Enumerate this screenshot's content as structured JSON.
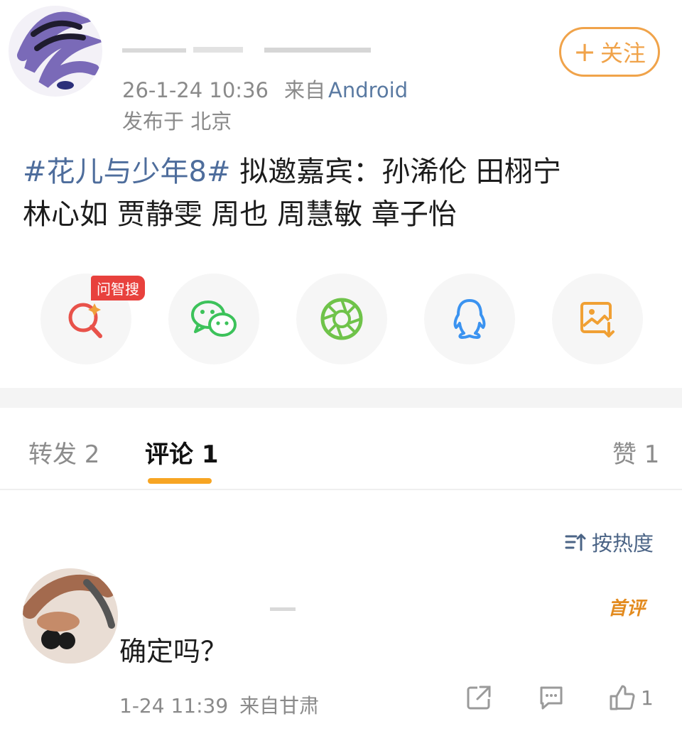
{
  "post": {
    "author_name": "",
    "timestamp": "26-1-24 10:36",
    "source_prefix": "来自",
    "source": "Android",
    "location": "发布于 北京",
    "follow_label": "关注",
    "hashtag": "#花儿与少年8#",
    "text_line1_rest": "拟邀嘉宾：孙浠伦 田栩宁",
    "text_line2": "林心如 贾静雯 周也 周慧敏 章子怡"
  },
  "share": {
    "ai_badge": "问智搜",
    "items": [
      "ai-search",
      "wechat",
      "moments",
      "qq",
      "save-image"
    ],
    "colors": {
      "ai_search": "#e8524a",
      "wechat": "#3cc25a",
      "moments": "#6fc34a",
      "qq": "#3b93f0",
      "save": "#f0a034"
    }
  },
  "tabs": {
    "repost": "转发 2",
    "comments": "评论 1",
    "likes": "赞 1"
  },
  "sort_label": "按热度",
  "comment": {
    "user_name": "",
    "first_badge": "首评",
    "text": "确定吗？",
    "time": "1-24 11:39",
    "location": "来自甘肃",
    "like_count": "1"
  },
  "colors": {
    "accent": "#f7a523",
    "link": "#4e6d9c",
    "follow": "#f0a34a"
  }
}
